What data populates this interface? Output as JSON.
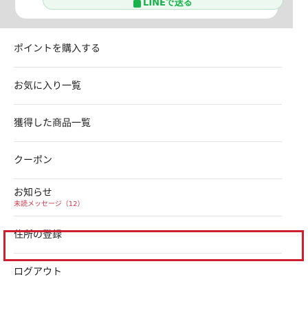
{
  "top_section": {
    "line_button_label": "LINEで送る"
  },
  "menu": {
    "items": [
      {
        "label": "ポイントを購入する"
      },
      {
        "label": "お気に入り一覧"
      },
      {
        "label": "獲得した商品一覧"
      },
      {
        "label": "クーポン"
      },
      {
        "label": "お知らせ",
        "sub": "未読メッセージ（12）"
      },
      {
        "label": "住所の登録"
      },
      {
        "label": "ログアウト"
      }
    ]
  },
  "colors": {
    "line_green": "#18b24a",
    "highlight_red": "#cf1f2e",
    "notice_red": "#d2384a"
  }
}
